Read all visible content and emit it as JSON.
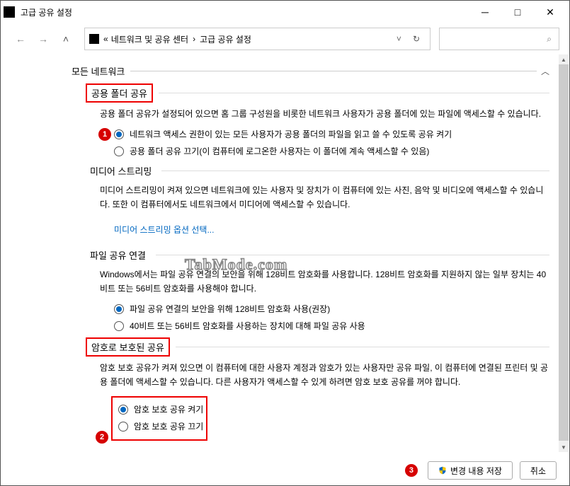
{
  "window": {
    "title": "고급 공유 설정"
  },
  "breadcrumb": {
    "prefix": "«",
    "part1": "네트워크 및 공유 센터",
    "sep": "›",
    "part2": "고급 공유 설정"
  },
  "header": {
    "all_networks": "모든 네트워크"
  },
  "public_folder": {
    "title": "공용 폴더 공유",
    "desc": "공용 폴더 공유가 설정되어 있으면 홈 그룹 구성원을 비롯한 네트워크 사용자가 공용 폴더에 있는 파일에 액세스할 수 있습니다.",
    "opt1": "네트워크 액세스 권한이 있는 모든 사용자가 공용 폴더의 파일을 읽고 쓸 수 있도록 공유 켜기",
    "opt2": "공용 폴더 공유 끄기(이 컴퓨터에 로그온한 사용자는 이 폴더에 계속 액세스할 수 있음)"
  },
  "media": {
    "title": "미디어 스트리밍",
    "desc": "미디어 스트리밍이 켜져 있으면 네트워크에 있는 사용자 및 장치가 이 컴퓨터에 있는 사진, 음악 및 비디오에 액세스할 수 있습니다. 또한 이 컴퓨터에서도 네트워크에서 미디어에 액세스할 수 있습니다.",
    "link": "미디어 스트리밍 옵션 선택..."
  },
  "file_conn": {
    "title": "파일 공유 연결",
    "desc": "Windows에서는 파일 공유 연결의 보안을 위해 128비트 암호화를 사용합니다. 128비트 암호화를 지원하지 않는 일부 장치는 40비트 또는 56비트 암호화를 사용해야 합니다.",
    "opt1": "파일 공유 연결의 보안을 위해 128비트 암호화 사용(권장)",
    "opt2": "40비트 또는 56비트 암호화를 사용하는 장치에 대해 파일 공유 사용"
  },
  "password": {
    "title": "암호로 보호된 공유",
    "desc": "암호 보호 공유가 켜져 있으면 이 컴퓨터에 대한 사용자 계정과 암호가 있는 사용자만 공유 파일, 이 컴퓨터에 연결된 프린터 및 공용 폴더에 액세스할 수 있습니다. 다른 사용자가 액세스할 수 있게 하려면 암호 보호 공유를 꺼야 합니다.",
    "opt1": "암호 보호 공유 켜기",
    "opt2": "암호 보호 공유 끄기"
  },
  "buttons": {
    "save": "변경 내용 저장",
    "cancel": "취소"
  },
  "badges": {
    "b1": "1",
    "b2": "2",
    "b3": "3"
  },
  "watermark": "TabMode.com"
}
